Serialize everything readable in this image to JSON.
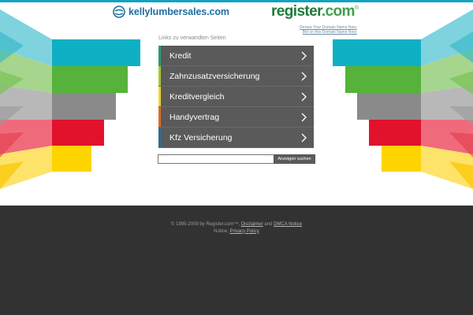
{
  "header": {
    "site_name": "kellylumbersales.com",
    "registrar_name": "register",
    "registrar_tld": ".com",
    "registrar_mark": "®",
    "links": [
      "Renew Your Domain Name Now.",
      "Bid on this Domain Name Now."
    ]
  },
  "main": {
    "section_title": "Links zu verwandten Seiten",
    "items": [
      {
        "label": "Kredit",
        "accent": "#2a9b6f"
      },
      {
        "label": "Zahnzusatzversicherung",
        "accent": "#a7c832"
      },
      {
        "label": "Kreditvergleich",
        "accent": "#f1d52a"
      },
      {
        "label": "Handyvertrag",
        "accent": "#e06a24"
      },
      {
        "label": "Kfz Versicherung",
        "accent": "#2c6c8e"
      }
    ],
    "search": {
      "value": "",
      "button_label": "Anzeigen suchen"
    }
  },
  "footer": {
    "copyright": "© 1995-2009 by Register.com™,",
    "disclaimer": "Disclaimer",
    "and": "and",
    "dmca": "DMCA Notice",
    "notice": "Notice,",
    "privacy": "Privacy Policy"
  },
  "colors": {
    "band_colors": [
      "#0fb0c4",
      "#56b23a",
      "#8a8a8a",
      "#e2122c",
      "#fdd400"
    ],
    "footer_bg": "#323232"
  }
}
